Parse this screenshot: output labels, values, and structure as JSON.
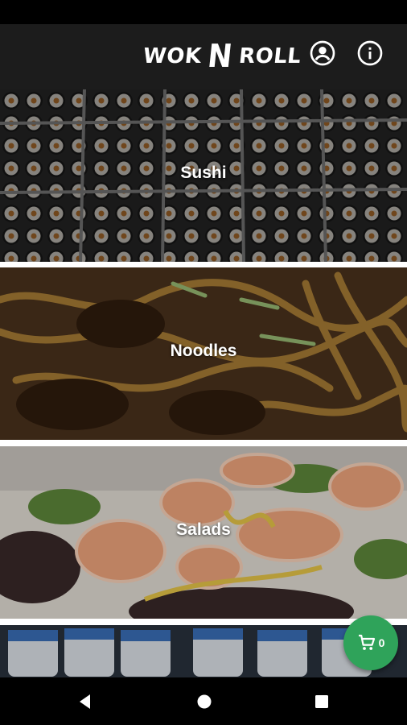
{
  "app": {
    "logo_left": "WOK",
    "logo_n": "N",
    "logo_right": "ROLL"
  },
  "header": {
    "account_icon": "account-circle-icon",
    "info_icon": "info-icon"
  },
  "categories": [
    {
      "label": "Sushi"
    },
    {
      "label": "Noodles"
    },
    {
      "label": "Salads"
    },
    {
      "label": ""
    }
  ],
  "cart": {
    "icon": "cart-icon",
    "count": "0",
    "color": "#2fa35a"
  },
  "nav": {
    "back": "back-icon",
    "home": "home-icon",
    "recents": "recents-icon"
  }
}
